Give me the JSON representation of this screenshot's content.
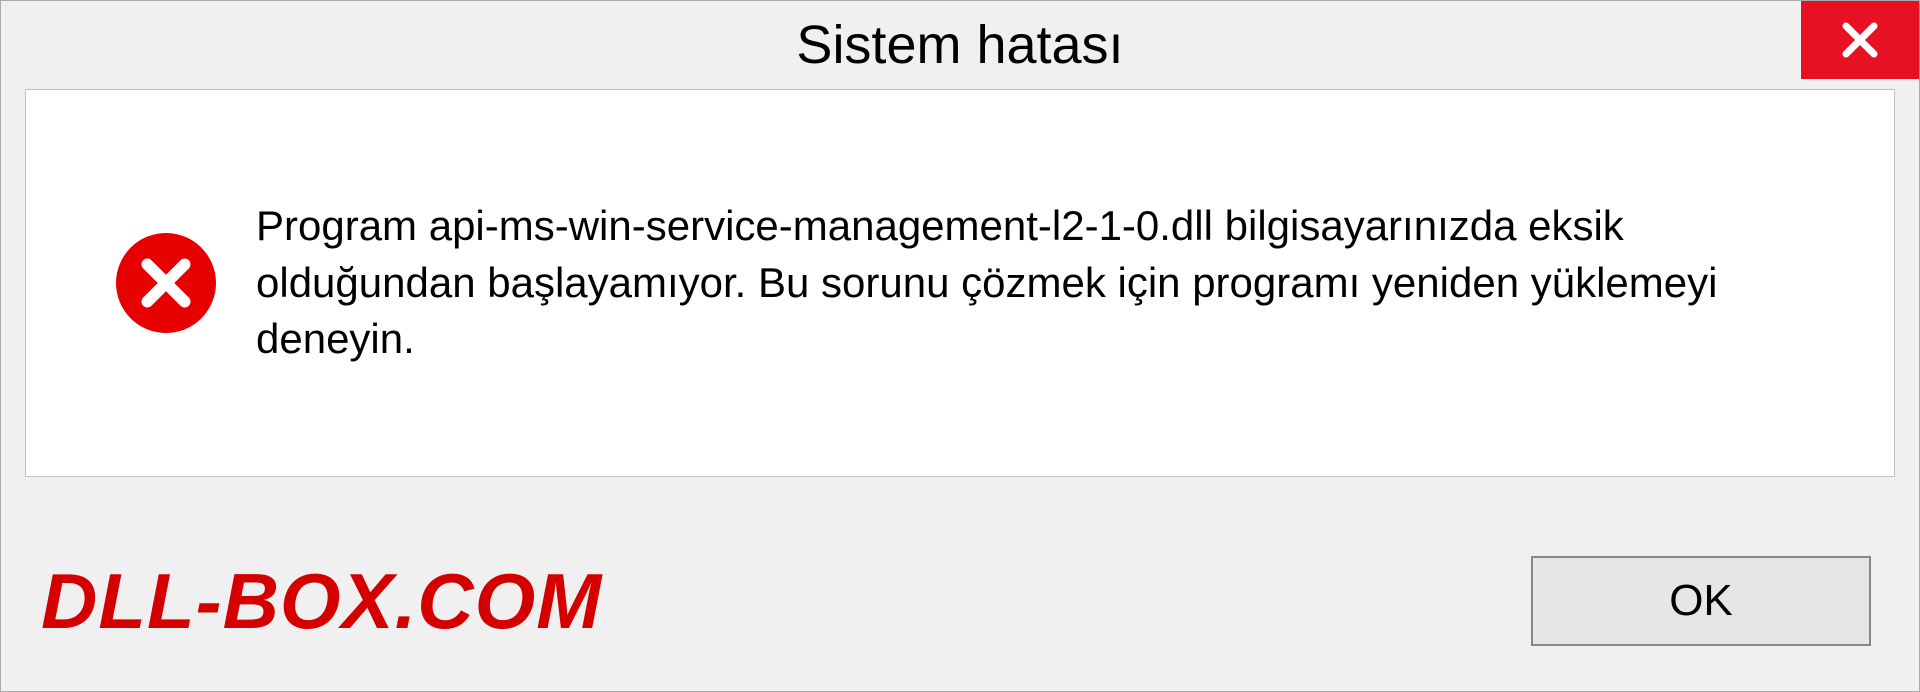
{
  "dialog": {
    "title": "Sistem hatası",
    "message": "Program api-ms-win-service-management-l2-1-0.dll bilgisayarınızda eksik olduğundan başlayamıyor. Bu sorunu çözmek için programı yeniden yüklemeyi deneyin.",
    "ok_label": "OK",
    "watermark": "DLL-BOX.COM"
  }
}
